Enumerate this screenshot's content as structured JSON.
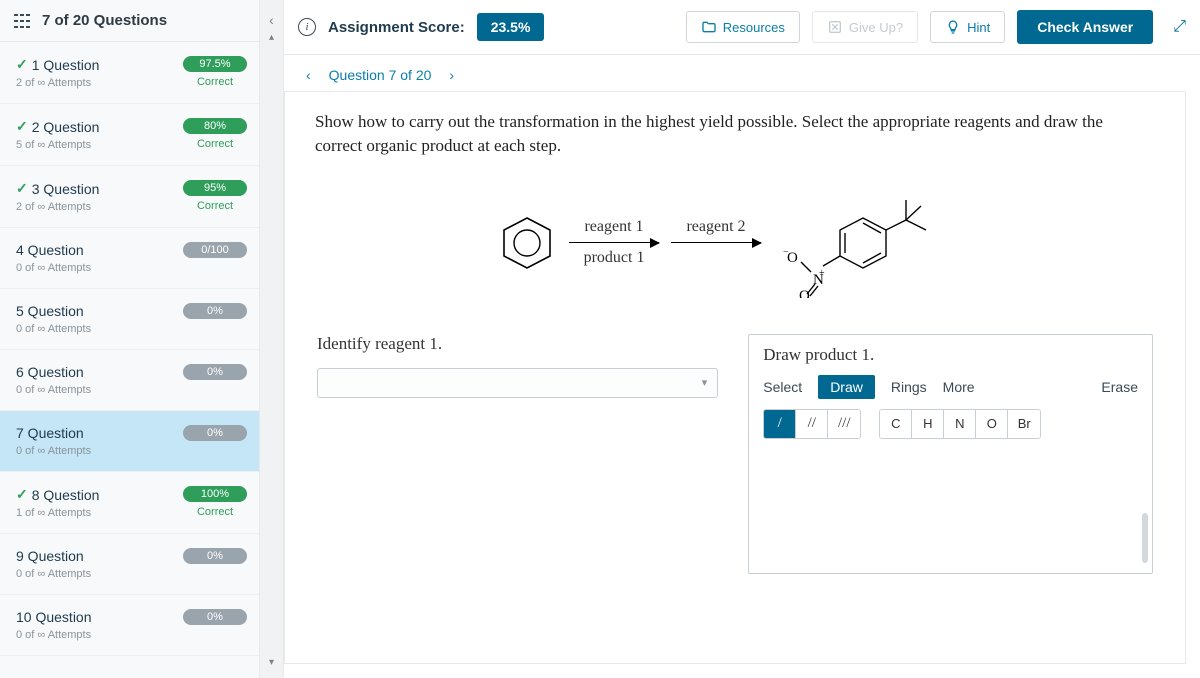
{
  "sidebar": {
    "header": "7 of 20 Questions",
    "items": [
      {
        "num": "1",
        "title": "Question",
        "attempts": "2 of ∞ Attempts",
        "score": "97.5%",
        "status": "Correct",
        "color": "green",
        "check": true
      },
      {
        "num": "2",
        "title": "Question",
        "attempts": "5 of ∞ Attempts",
        "score": "80%",
        "status": "Correct",
        "color": "green",
        "check": true
      },
      {
        "num": "3",
        "title": "Question",
        "attempts": "2 of ∞ Attempts",
        "score": "95%",
        "status": "Correct",
        "color": "green",
        "check": true
      },
      {
        "num": "4",
        "title": "Question",
        "attempts": "0 of ∞ Attempts",
        "score": "0/100",
        "status": "",
        "color": "gray",
        "check": false
      },
      {
        "num": "5",
        "title": "Question",
        "attempts": "0 of ∞ Attempts",
        "score": "0%",
        "status": "",
        "color": "gray",
        "check": false
      },
      {
        "num": "6",
        "title": "Question",
        "attempts": "0 of ∞ Attempts",
        "score": "0%",
        "status": "",
        "color": "gray",
        "check": false
      },
      {
        "num": "7",
        "title": "Question",
        "attempts": "0 of ∞ Attempts",
        "score": "0%",
        "status": "",
        "color": "gray",
        "check": false,
        "selected": true
      },
      {
        "num": "8",
        "title": "Question",
        "attempts": "1 of ∞ Attempts",
        "score": "100%",
        "status": "Correct",
        "color": "green",
        "check": true
      },
      {
        "num": "9",
        "title": "Question",
        "attempts": "0 of ∞ Attempts",
        "score": "0%",
        "status": "",
        "color": "gray",
        "check": false
      },
      {
        "num": "10",
        "title": "Question",
        "attempts": "0 of ∞ Attempts",
        "score": "0%",
        "status": "",
        "color": "gray",
        "check": false
      }
    ]
  },
  "topbar": {
    "score_label": "Assignment Score:",
    "score_value": "23.5%",
    "resources": "Resources",
    "giveup": "Give Up?",
    "hint": "Hint",
    "check": "Check Answer"
  },
  "subbar": {
    "label": "Question 7 of 20"
  },
  "prompt": "Show how to carry out the transformation in the highest yield possible. Select the appropriate reagents and draw the correct organic product at each step.",
  "diagram": {
    "reagent1": "reagent 1",
    "product1": "product 1",
    "reagent2": "reagent 2"
  },
  "identify": {
    "label": "Identify reagent 1."
  },
  "draw": {
    "label": "Draw product 1.",
    "tabs": {
      "select": "Select",
      "draw": "Draw",
      "rings": "Rings",
      "more": "More",
      "erase": "Erase"
    },
    "bonds": [
      "/",
      "//",
      "///"
    ],
    "elements": [
      "C",
      "H",
      "N",
      "O",
      "Br"
    ]
  }
}
